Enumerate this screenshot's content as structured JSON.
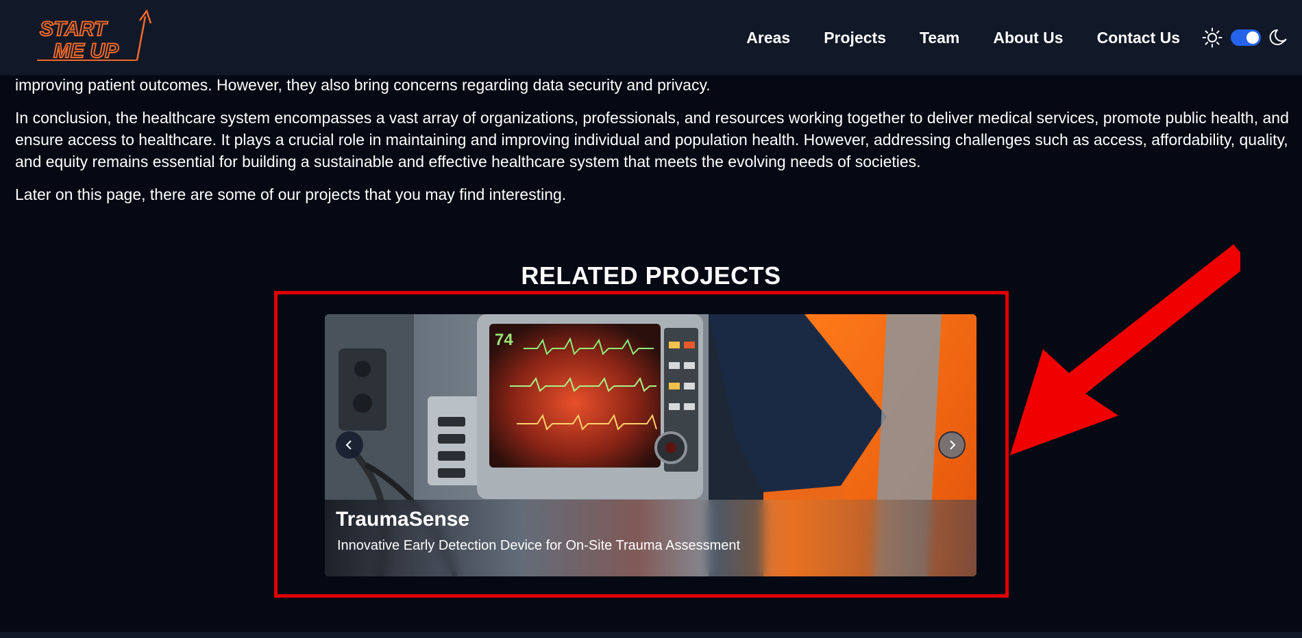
{
  "header": {
    "logo_line1": "START",
    "logo_line2": "ME UP",
    "nav": [
      "Areas",
      "Projects",
      "Team",
      "About Us",
      "Contact Us"
    ],
    "theme_toggle": {
      "light_icon": "sun-icon",
      "dark_icon": "moon-icon",
      "state": "dark"
    }
  },
  "article": {
    "paragraphs": [
      "improving patient outcomes. However, they also bring concerns regarding data security and privacy.",
      "In conclusion, the healthcare system encompasses a vast array of organizations, professionals, and resources working together to deliver medical services, promote public health, and ensure access to healthcare. It plays a crucial role in maintaining and improving individual and population health. However, addressing challenges such as access, affordability, quality, and equity remains essential for building a sustainable and effective healthcare system that meets the evolving needs of societies.",
      "Later on this page, there are some of our projects that you may find interesting."
    ]
  },
  "related": {
    "title": "RELATED PROJECTS",
    "slide": {
      "title": "TraumaSense",
      "subtitle": "Innovative Early Detection Device for On-Site Trauma Assessment",
      "monitor_reading": "74"
    },
    "prev_icon": "chevron-left-icon",
    "next_icon": "chevron-right-icon"
  },
  "colors": {
    "header_bg": "#111827",
    "page_bg": "#050913",
    "brand": "#f26b2a",
    "toggle_on": "#2563eb",
    "highlight": "#e00000"
  }
}
